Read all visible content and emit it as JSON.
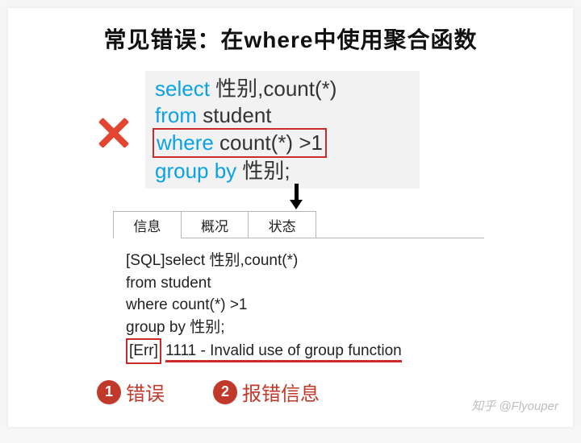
{
  "title": "常见错误：在where中使用聚合函数",
  "code": {
    "l1a": "select",
    "l1b": " 性别,count(*)",
    "l2a": "from",
    "l2b": " student",
    "l3a": "where",
    "l3b": " count(*) >1",
    "l4a": "group by",
    "l4b": " 性别;"
  },
  "tabs": {
    "t1": "信息",
    "t2": "概况",
    "t3": "状态"
  },
  "msg": {
    "l1": "[SQL]select 性别,count(*)",
    "l2": "from student",
    "l3": "where count(*) >1",
    "l4": "group by 性别;",
    "errTag": "[Err]",
    "errText": "1111 - Invalid use of group function"
  },
  "legend": {
    "n1": "1",
    "t1": "错误",
    "n2": "2",
    "t2": "报错信息"
  },
  "watermark": "知乎 @Flyouper"
}
